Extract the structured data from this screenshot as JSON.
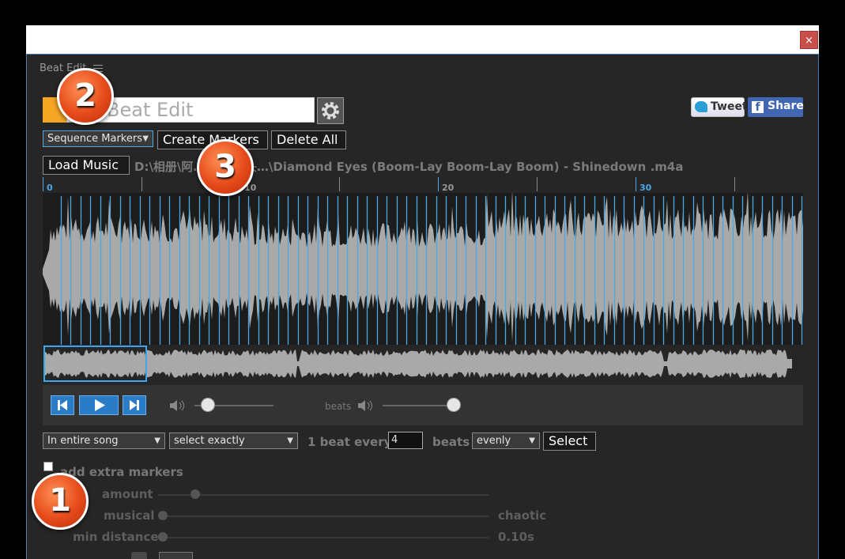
{
  "window": {
    "close_label": "×"
  },
  "app": {
    "tab_title": "Beat Edit",
    "menu_icon": "hamburger-menu-icon",
    "project_placeholder": "Beat Edit",
    "settings_icon": "gear-icon"
  },
  "social": {
    "tweet_label": "Tweet",
    "share_label": "Share"
  },
  "toolbar": {
    "marker_type": "Sequence Markers",
    "create_markers_label": "Create Markers",
    "delete_all_label": "Delete All",
    "load_music_label": "Load Music",
    "file_path": "D:\\相册\\阿…文本库\\头…\\Diamond Eyes (Boom-Lay Boom-Lay Boom) - Shinedown .m4a"
  },
  "timeline": {
    "ticks": [
      "0",
      "10",
      "20",
      "30"
    ]
  },
  "playback": {
    "beats_label": "beats",
    "volume": 0.05,
    "beats_volume": 0.95
  },
  "selection": {
    "scope": "In entire song",
    "mode": "select exactly",
    "beat_every_label": "1 beat every",
    "beat_every_value": "4",
    "beats_label": "beats",
    "distribution": "evenly",
    "select_label": "Select"
  },
  "extra": {
    "checkbox_label": "add extra markers",
    "amount_label": "amount",
    "musical_label": "musical",
    "chaotic_label": "chaotic",
    "min_distance_label": "min distance",
    "min_distance_value": "0.10s"
  },
  "annotations": [
    "1",
    "2",
    "3"
  ],
  "colors": {
    "accent": "#4aa8e8",
    "badge": "#e64a1a",
    "panel": "#262626"
  }
}
